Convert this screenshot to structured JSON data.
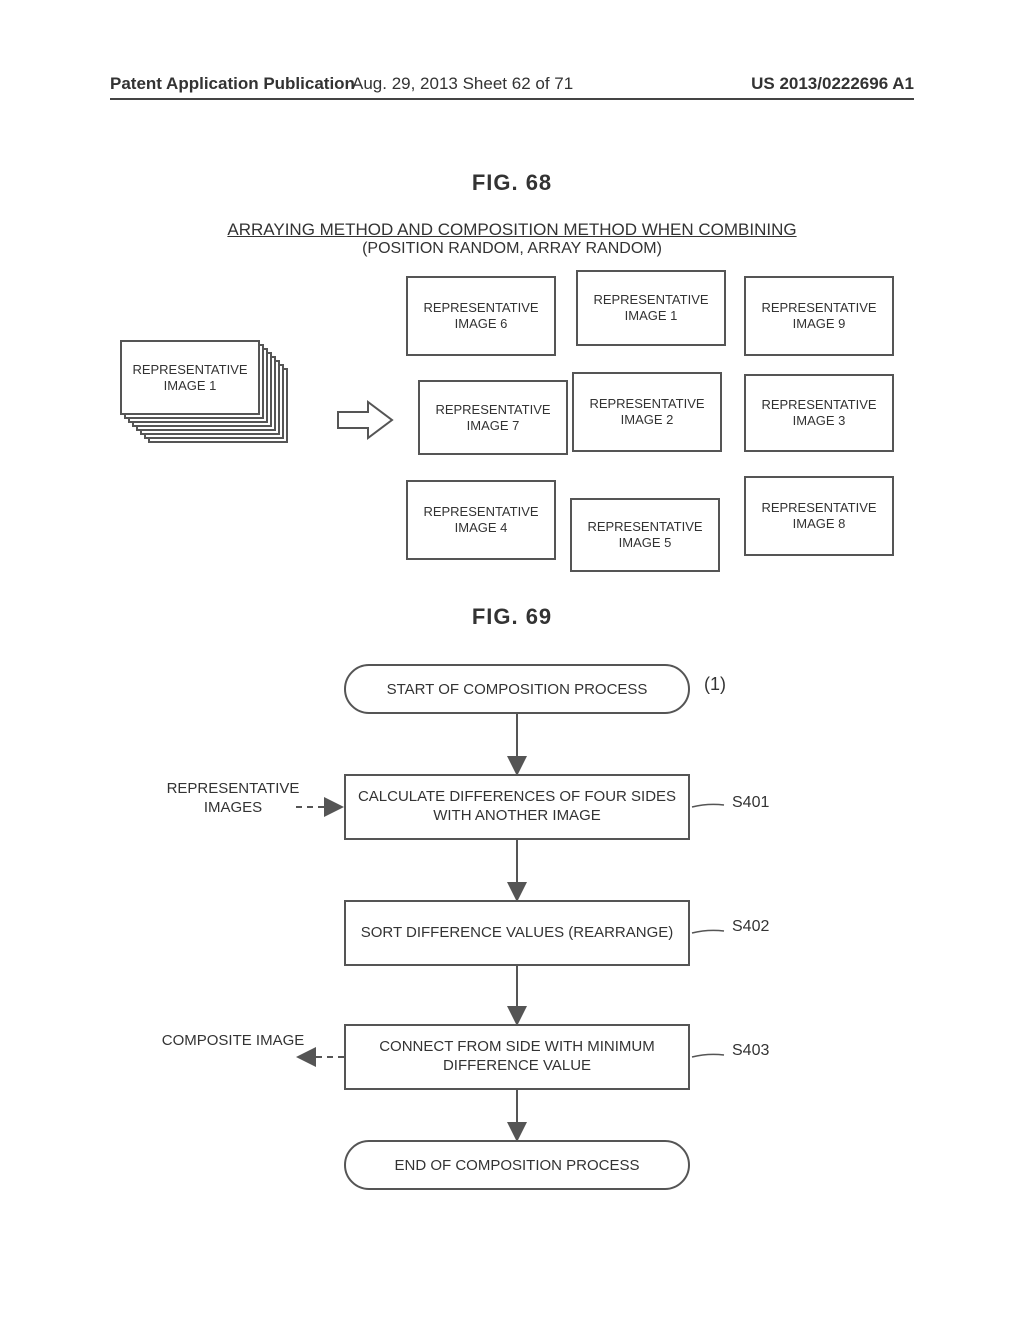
{
  "header": {
    "left": "Patent Application Publication",
    "mid": "Aug. 29, 2013  Sheet 62 of 71",
    "right": "US 2013/0222696 A1"
  },
  "fig68": {
    "label": "FIG. 68",
    "title_line1": "ARRAYING METHOD AND COMPOSITION METHOD WHEN COMBINING",
    "title_line2": "(POSITION RANDOM, ARRAY RANDOM)",
    "stack_label": "REPRESENTATIVE IMAGE 1",
    "grid": {
      "c6": "REPRESENTATIVE IMAGE 6",
      "c1": "REPRESENTATIVE IMAGE 1",
      "c9": "REPRESENTATIVE IMAGE 9",
      "c7": "REPRESENTATIVE IMAGE 7",
      "c2": "REPRESENTATIVE IMAGE 2",
      "c3": "REPRESENTATIVE IMAGE 3",
      "c4": "REPRESENTATIVE IMAGE 4",
      "c5": "REPRESENTATIVE IMAGE 5",
      "c8": "REPRESENTATIVE IMAGE 8"
    }
  },
  "fig69": {
    "label": "FIG. 69",
    "start": "START OF COMPOSITION PROCESS",
    "paren": "(1)",
    "steps": {
      "s401": {
        "text": "CALCULATE DIFFERENCES OF FOUR SIDES WITH ANOTHER IMAGE",
        "ref": "S401"
      },
      "s402": {
        "text": "SORT DIFFERENCE VALUES (REARRANGE)",
        "ref": "S402"
      },
      "s403": {
        "text": "CONNECT FROM SIDE WITH MINIMUM DIFFERENCE VALUE",
        "ref": "S403"
      }
    },
    "side": {
      "rep": "REPRESENTATIVE IMAGES",
      "comp": "COMPOSITE IMAGE"
    },
    "end": "END OF COMPOSITION PROCESS"
  }
}
